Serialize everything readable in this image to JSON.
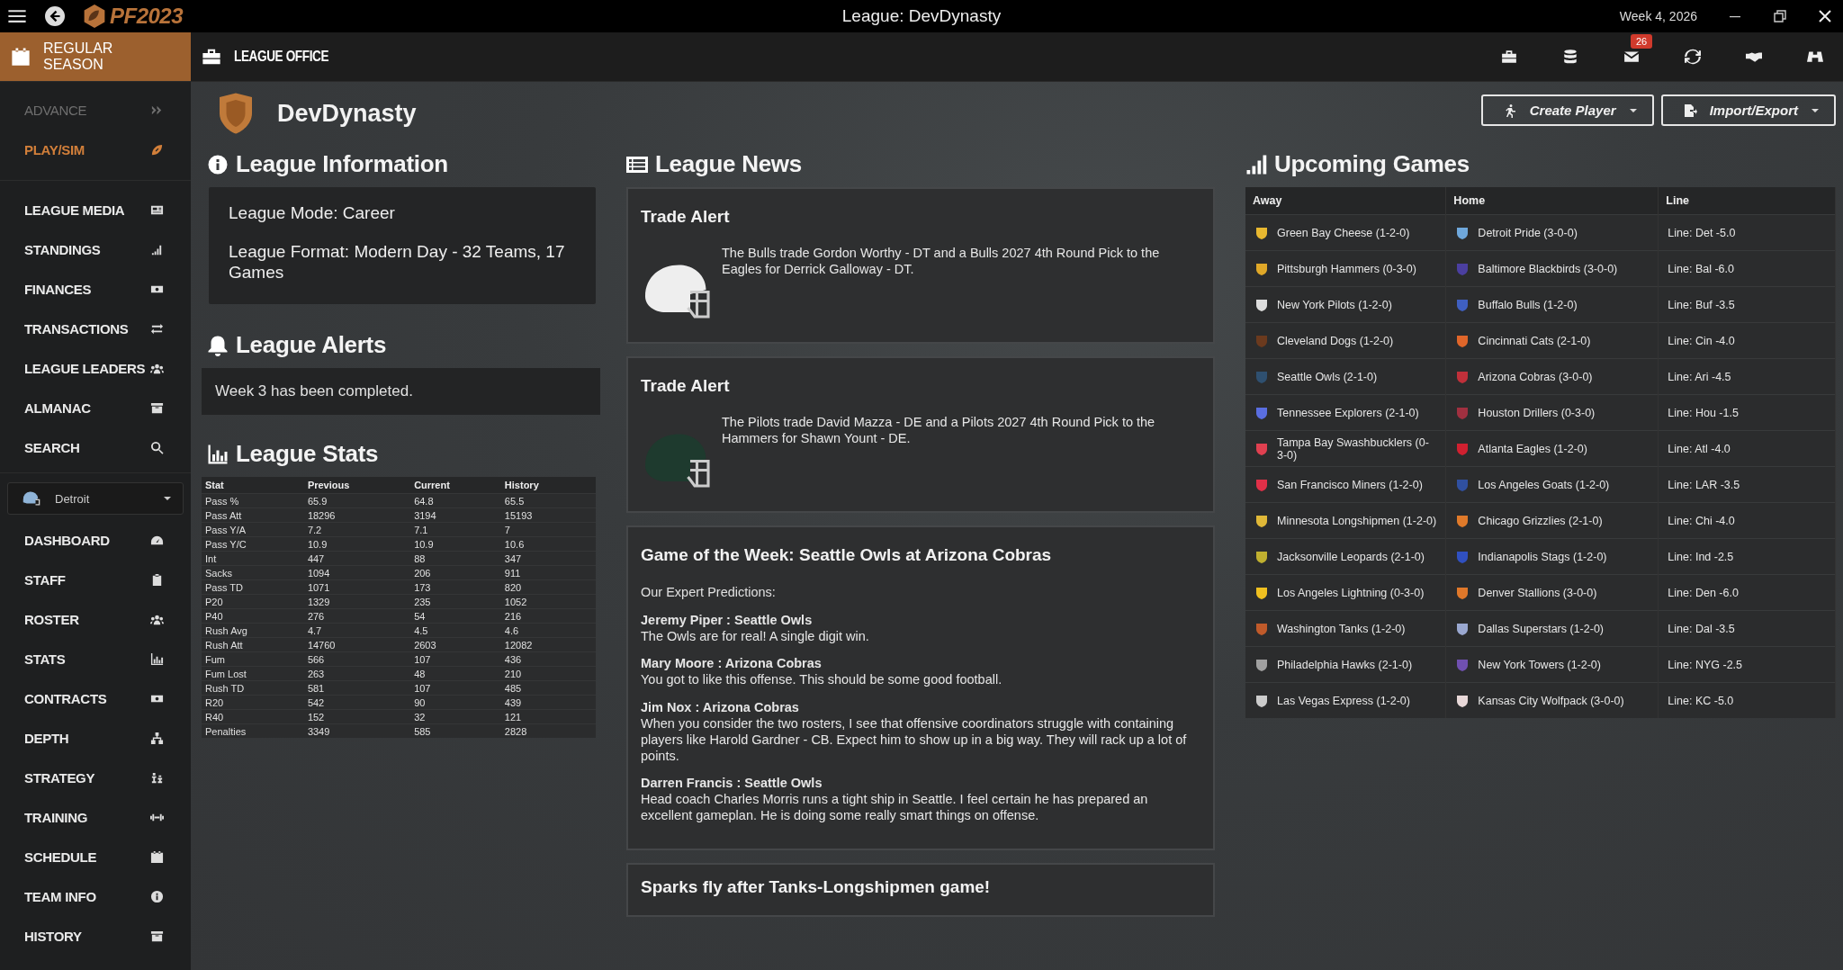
{
  "title_bar": {
    "logo": "PF2023",
    "title": "League: DevDynasty",
    "date": "Week 4, 2026"
  },
  "nav_tabs": [
    {
      "label": "REGULAR SEASON",
      "selected": true
    },
    {
      "label": "LEAGUE OFFICE",
      "selected": false
    }
  ],
  "mail_badge": "26",
  "sidebar": {
    "actions": [
      {
        "label": "ADVANCE",
        "disabled": true
      },
      {
        "label": "PLAY/SIM",
        "disabled": false
      }
    ],
    "league_items": [
      "LEAGUE MEDIA",
      "STANDINGS",
      "FINANCES",
      "TRANSACTIONS",
      "LEAGUE LEADERS",
      "ALMANAC",
      "SEARCH"
    ],
    "team_select": {
      "value": "Detroit"
    },
    "team_items": [
      "DASHBOARD",
      "STAFF",
      "ROSTER",
      "STATS",
      "CONTRACTS",
      "DEPTH",
      "STRATEGY",
      "TRAINING",
      "SCHEDULE",
      "TEAM INFO",
      "HISTORY"
    ]
  },
  "league_name": "DevDynasty",
  "buttons": [
    "Create Player",
    "Import/Export"
  ],
  "league_information": {
    "title": "League Information",
    "lines": [
      "League Mode: Career",
      "League Format: Modern Day - 32 Teams, 17 Games"
    ]
  },
  "league_alerts": {
    "title": "League Alerts",
    "items": [
      "Week 3 has been completed."
    ]
  },
  "league_stats": {
    "title": "League Stats",
    "columns": [
      "Stat",
      "Previous",
      "Current",
      "History"
    ],
    "rows": [
      [
        "Pass %",
        "65.9",
        "64.8",
        "65.5"
      ],
      [
        "Pass Att",
        "18296",
        "3194",
        "15193"
      ],
      [
        "Pass Y/A",
        "7.2",
        "7.1",
        "7"
      ],
      [
        "Pass Y/C",
        "10.9",
        "10.9",
        "10.6"
      ],
      [
        "Int",
        "447",
        "88",
        "347"
      ],
      [
        "Sacks",
        "1094",
        "206",
        "911"
      ],
      [
        "Pass TD",
        "1071",
        "173",
        "820"
      ],
      [
        "P20",
        "1329",
        "235",
        "1052"
      ],
      [
        "P40",
        "276",
        "54",
        "216"
      ],
      [
        "Rush Avg",
        "4.7",
        "4.5",
        "4.6"
      ],
      [
        "Rush Att",
        "14760",
        "2603",
        "12082"
      ],
      [
        "Fum",
        "566",
        "107",
        "436"
      ],
      [
        "Fum Lost",
        "263",
        "48",
        "210"
      ],
      [
        "Rush TD",
        "581",
        "107",
        "485"
      ],
      [
        "R20",
        "542",
        "90",
        "439"
      ],
      [
        "R40",
        "152",
        "32",
        "121"
      ],
      [
        "Penalties",
        "3349",
        "585",
        "2828"
      ]
    ]
  },
  "league_news": {
    "title": "League News",
    "items": [
      {
        "kind": "trade",
        "title": "Trade Alert",
        "color": "#eeeeee",
        "text": "The Bulls trade Gordon Worthy - DT and a Bulls 2027 4th Round Pick to the Eagles for Derrick Galloway - DT."
      },
      {
        "kind": "trade",
        "title": "Trade Alert",
        "color": "#1e3a2e",
        "text": "The Pilots trade David Mazza - DE and a Pilots 2027 4th Round Pick to the Hammers for Shawn Yount - DE."
      },
      {
        "kind": "predictions",
        "title": "Game of the Week: Seattle Owls at Arizona Cobras",
        "intro": "Our Expert Predictions:",
        "predictions": [
          {
            "pick": "Jeremy Piper : Seattle Owls",
            "text": "The Owls are for real! A single digit win."
          },
          {
            "pick": "Mary Moore : Arizona Cobras",
            "text": "You got to like this offense. This should be some good football."
          },
          {
            "pick": "Jim Nox : Arizona Cobras",
            "text": "When you consider the two rosters, I see that offensive coordinators struggle with containing players like Harold Gardner - CB. Expect him to show up in a big way. They will rack up a lot of points."
          },
          {
            "pick": "Darren Francis : Seattle Owls",
            "text": "Head coach Charles Morris runs a tight ship in Seattle. I feel certain he has prepared an excellent gameplan. He is doing some really smart things on offense."
          }
        ]
      },
      {
        "kind": "headline",
        "title": "Sparks fly after Tanks-Longshipmen game!"
      }
    ]
  },
  "upcoming_games": {
    "title": "Upcoming Games",
    "columns": [
      "Away",
      "Home",
      "Line"
    ],
    "rows": [
      {
        "away": {
          "team": "Green Bay Cheese (1-2-0)",
          "color": "#e8b830"
        },
        "home": {
          "team": "Detroit Pride (3-0-0)",
          "color": "#6fa8dc"
        },
        "line": "Line: Det -5.0"
      },
      {
        "away": {
          "team": "Pittsburgh Hammers (0-3-0)",
          "color": "#e0a828"
        },
        "home": {
          "team": "Baltimore Blackbirds (3-0-0)",
          "color": "#4b3fa0"
        },
        "line": "Line: Bal -6.0"
      },
      {
        "away": {
          "team": "New York Pilots (1-2-0)",
          "color": "#dddddd"
        },
        "home": {
          "team": "Buffalo Bulls (1-2-0)",
          "color": "#3f5fc0"
        },
        "line": "Line: Buf -3.5"
      },
      {
        "away": {
          "team": "Cleveland Dogs (1-2-0)",
          "color": "#6b3a1e"
        },
        "home": {
          "team": "Cincinnati Cats (2-1-0)",
          "color": "#e0662a"
        },
        "line": "Line: Cin -4.0"
      },
      {
        "away": {
          "team": "Seattle Owls (2-1-0)",
          "color": "#2f5070"
        },
        "home": {
          "team": "Arizona Cobras (3-0-0)",
          "color": "#c0303a"
        },
        "line": "Line: Ari -4.5"
      },
      {
        "away": {
          "team": "Tennessee Explorers (2-1-0)",
          "color": "#5a6ee0"
        },
        "home": {
          "team": "Houston Drillers (0-3-0)",
          "color": "#a03040"
        },
        "line": "Line: Hou -1.5"
      },
      {
        "away": {
          "team": "Tampa Bay Swashbucklers (0-3-0)",
          "color": "#e04050"
        },
        "home": {
          "team": "Atlanta Eagles (1-2-0)",
          "color": "#d02030"
        },
        "line": "Line: Atl -4.0"
      },
      {
        "away": {
          "team": "San Francisco Miners (1-2-0)",
          "color": "#e03048"
        },
        "home": {
          "team": "Los Angeles Goats (1-2-0)",
          "color": "#3050a0"
        },
        "line": "Line: LAR -3.5"
      },
      {
        "away": {
          "team": "Minnesota Longshipmen (1-2-0)",
          "color": "#e0b838"
        },
        "home": {
          "team": "Chicago Grizzlies (2-1-0)",
          "color": "#e07a2a"
        },
        "line": "Line: Chi -4.0"
      },
      {
        "away": {
          "team": "Jacksonville Leopards (2-1-0)",
          "color": "#c0b030"
        },
        "home": {
          "team": "Indianapolis Stags (1-2-0)",
          "color": "#3050c0"
        },
        "line": "Line: Ind -2.5"
      },
      {
        "away": {
          "team": "Los Angeles Lightning (0-3-0)",
          "color": "#f0c020"
        },
        "home": {
          "team": "Denver Stallions (3-0-0)",
          "color": "#e0782a"
        },
        "line": "Line: Den -6.0"
      },
      {
        "away": {
          "team": "Washington Tanks (1-2-0)",
          "color": "#c05a2a"
        },
        "home": {
          "team": "Dallas Superstars (1-2-0)",
          "color": "#9aa8d0"
        },
        "line": "Line: Dal -3.5"
      },
      {
        "away": {
          "team": "Philadelphia Hawks (2-1-0)",
          "color": "#a0a0a0"
        },
        "home": {
          "team": "New York Towers (1-2-0)",
          "color": "#7050b0"
        },
        "line": "Line: NYG -2.5"
      },
      {
        "away": {
          "team": "Las Vegas Express (1-2-0)",
          "color": "#cccccc"
        },
        "home": {
          "team": "Kansas City Wolfpack (3-0-0)",
          "color": "#e8d8d8"
        },
        "line": "Line: KC -5.0"
      }
    ]
  }
}
